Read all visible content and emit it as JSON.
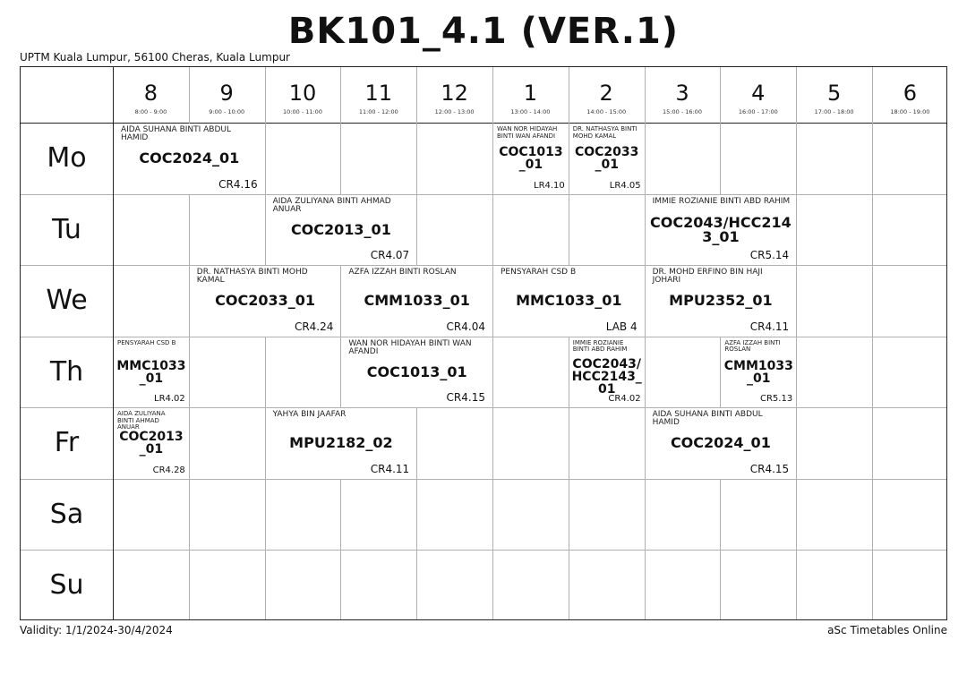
{
  "header": {
    "title": "BK101_4.1 (VER.1)",
    "address": "UPTM Kuala Lumpur, 56100 Cheras, Kuala Lumpur"
  },
  "footer": {
    "validity": "Validity: 1/1/2024-30/4/2024",
    "credit": "aSc Timetables Online"
  },
  "periods": [
    {
      "label": "8",
      "time": "8:00 - 9:00"
    },
    {
      "label": "9",
      "time": "9:00 - 10:00"
    },
    {
      "label": "10",
      "time": "10:00 - 11:00"
    },
    {
      "label": "11",
      "time": "11:00 - 12:00"
    },
    {
      "label": "12",
      "time": "12:00 - 13:00"
    },
    {
      "label": "1",
      "time": "13:00 - 14:00"
    },
    {
      "label": "2",
      "time": "14:00 - 15:00"
    },
    {
      "label": "3",
      "time": "15:00 - 16:00"
    },
    {
      "label": "4",
      "time": "16:00 - 17:00"
    },
    {
      "label": "5",
      "time": "17:00 - 18:00"
    },
    {
      "label": "6",
      "time": "18:00 - 19:00"
    }
  ],
  "days": [
    "Mo",
    "Tu",
    "We",
    "Th",
    "Fr",
    "Sa",
    "Su"
  ],
  "lessons": [
    {
      "day": 0,
      "start": 0,
      "span": 2,
      "teacher": "AIDA SUHANA BINTI ABDUL HAMID",
      "subject": "COC2024_01",
      "room": "CR4.16"
    },
    {
      "day": 0,
      "start": 5,
      "span": 1,
      "teacher": "WAN NOR HIDAYAH BINTI WAN AFANDI",
      "subject": "COC1013\n_01",
      "room": "LR4.10"
    },
    {
      "day": 0,
      "start": 6,
      "span": 1,
      "teacher": "DR. NATHASYA BINTI MOHD KAMAL",
      "subject": "COC2033\n_01",
      "room": "LR4.05"
    },
    {
      "day": 1,
      "start": 2,
      "span": 2,
      "teacher": "AIDA ZULIYANA BINTI AHMAD ANUAR",
      "subject": "COC2013_01",
      "room": "CR4.07"
    },
    {
      "day": 1,
      "start": 7,
      "span": 2,
      "teacher": "IMMIE ROZIANIE BINTI ABD RAHIM",
      "subject": "COC2043/HCC214\n3_01",
      "room": "CR5.14"
    },
    {
      "day": 2,
      "start": 1,
      "span": 2,
      "teacher": "DR. NATHASYA BINTI MOHD KAMAL",
      "subject": "COC2033_01",
      "room": "CR4.24"
    },
    {
      "day": 2,
      "start": 3,
      "span": 2,
      "teacher": "AZFA IZZAH BINTI ROSLAN",
      "subject": "CMM1033_01",
      "room": "CR4.04"
    },
    {
      "day": 2,
      "start": 5,
      "span": 2,
      "teacher": "PENSYARAH CSD B",
      "subject": "MMC1033_01",
      "room": "LAB 4"
    },
    {
      "day": 2,
      "start": 7,
      "span": 2,
      "teacher": "DR. MOHD ERFINO BIN HAJI JOHARI",
      "subject": "MPU2352_01",
      "room": "CR4.11"
    },
    {
      "day": 3,
      "start": 0,
      "span": 1,
      "teacher": "PENSYARAH CSD B",
      "subject": "MMC1033\n_01",
      "room": "LR4.02"
    },
    {
      "day": 3,
      "start": 3,
      "span": 2,
      "teacher": "WAN NOR HIDAYAH BINTI WAN AFANDI",
      "subject": "COC1013_01",
      "room": "CR4.15"
    },
    {
      "day": 3,
      "start": 6,
      "span": 1,
      "teacher": "IMMIE ROZIANIE BINTI ABD RAHIM",
      "subject": "COC2043/\nHCC2143_\n01",
      "room": "CR4.02"
    },
    {
      "day": 3,
      "start": 8,
      "span": 1,
      "teacher": "AZFA IZZAH BINTI ROSLAN",
      "subject": "CMM1033\n_01",
      "room": "CR5.13"
    },
    {
      "day": 4,
      "start": 0,
      "span": 1,
      "teacher": "AIDA ZULIYANA BINTI AHMAD ANUAR",
      "subject": "COC2013\n_01",
      "room": "CR4.28"
    },
    {
      "day": 4,
      "start": 2,
      "span": 2,
      "teacher": "YAHYA BIN JAAFAR",
      "subject": "MPU2182_02",
      "room": "CR4.11"
    },
    {
      "day": 4,
      "start": 7,
      "span": 2,
      "teacher": "AIDA SUHANA BINTI ABDUL HAMID",
      "subject": "COC2024_01",
      "room": "CR4.15"
    }
  ]
}
